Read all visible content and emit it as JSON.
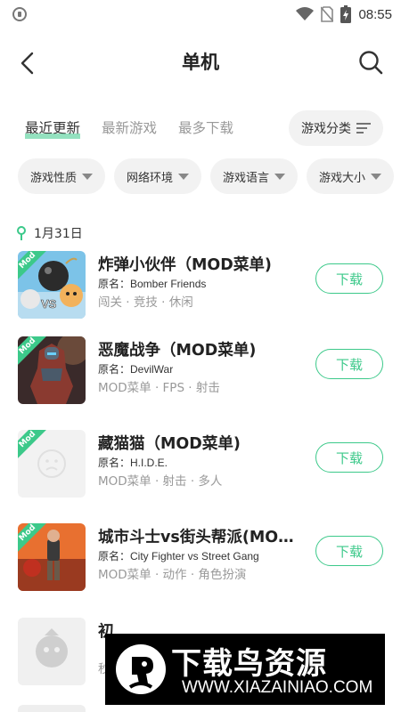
{
  "status_bar": {
    "time": "08:55"
  },
  "header": {
    "title": "单机"
  },
  "tabs": [
    {
      "label": "最近更新",
      "active": true
    },
    {
      "label": "最新游戏",
      "active": false
    },
    {
      "label": "最多下载",
      "active": false
    }
  ],
  "category_button": {
    "label": "游戏分类"
  },
  "filters": [
    {
      "label": "游戏性质"
    },
    {
      "label": "网络环境"
    },
    {
      "label": "游戏语言"
    },
    {
      "label": "游戏大小"
    }
  ],
  "date_label": "1月31日",
  "games": [
    {
      "name": "炸弹小伙伴（MOD菜单)",
      "original": "原名：Bomber Friends",
      "tags": "闯关 · 竞技 · 休闲",
      "badge": "Mod",
      "download_label": "下载"
    },
    {
      "name": "恶魔战争（MOD菜单)",
      "original": "原名：DevilWar",
      "tags": "MOD菜单 · FPS · 射击",
      "badge": "Mod",
      "download_label": "下载"
    },
    {
      "name": "藏猫猫（MOD菜单)",
      "original": "原名：H.I.D.E.",
      "tags": "MOD菜单 · 射击 · 多人",
      "badge": "Mod",
      "download_label": "下载"
    },
    {
      "name": "城市斗士vs街头帮派(MOD...",
      "original": "原名：City Fighter vs Street Gang",
      "tags": "MOD菜单 · 动作 · 角色扮演",
      "badge": "Mod",
      "download_label": "下载"
    },
    {
      "name": "初",
      "original": "",
      "tags": "秒",
      "badge": "",
      "download_label": ""
    }
  ],
  "watermark": {
    "text": "下载鸟资源",
    "url": "WWW.XIAZAINIAO.COM"
  },
  "colors": {
    "accent": "#3cc98a",
    "muted": "#999999"
  }
}
